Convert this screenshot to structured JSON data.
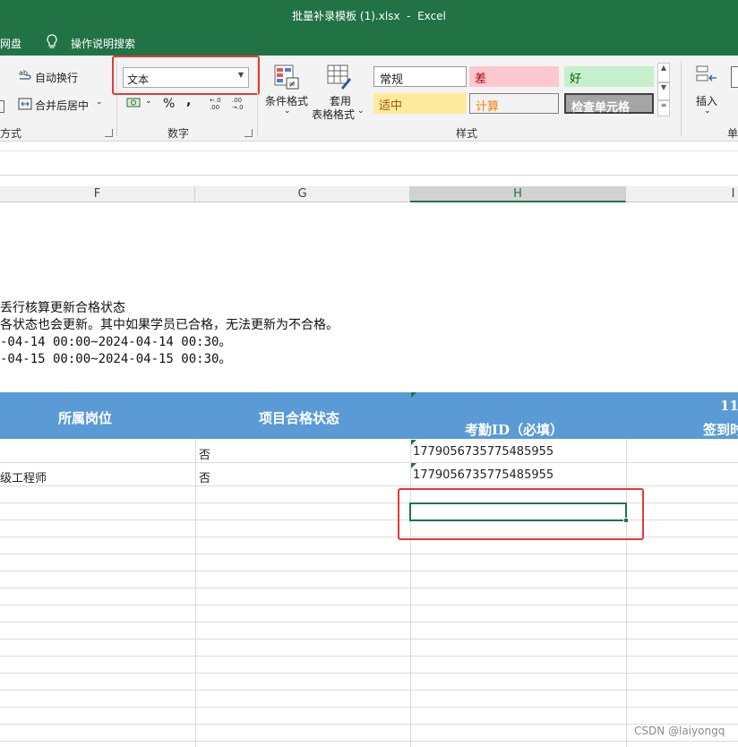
{
  "window": {
    "title": "批量补录模板 (1).xlsx  -  Excel"
  },
  "menu": {
    "item_left": "网盘",
    "tell_me": "操作说明搜索"
  },
  "ribbon": {
    "alignment": {
      "wrap_text": "自动换行",
      "merge_center": "合并后居中",
      "group_label": "方式"
    },
    "number": {
      "format_value": "文本",
      "percent": "%",
      "comma": ",",
      "inc_decimal": "←.0\n.00",
      "dec_decimal": ".00\n→.0",
      "group_label": "数字"
    },
    "styles": {
      "conditional_format": "条件格式",
      "format_as_table_1": "套用",
      "format_as_table_2": "表格格式",
      "cells": [
        {
          "label": "常规",
          "bg": "#ffffff",
          "color": "#222222"
        },
        {
          "label": "差",
          "bg": "#ffc7ce",
          "color": "#9c0006"
        },
        {
          "label": "好",
          "bg": "#c6efce",
          "color": "#006100"
        },
        {
          "label": "适中",
          "bg": "#ffeb9c",
          "color": "#9c5700"
        },
        {
          "label": "计算",
          "bg": "#f2f2f2",
          "color": "#fa7d00"
        },
        {
          "label": "检查单元格",
          "bg": "#a5a5a5",
          "color": "#ffffff"
        }
      ],
      "group_label": "样式"
    },
    "cells_group": {
      "insert": "插入",
      "label_partial": "单"
    }
  },
  "columns": [
    "F",
    "G",
    "H",
    "I"
  ],
  "selected_column": "H",
  "notes": [
    "丢行核算更新合格状态",
    "各状态也会更新。其中如果学员已合格，无法更新为不合格。",
    "-04-14 00:00~2024-04-14 00:30。",
    "-04-15 00:00~2024-04-15 00:30。"
  ],
  "header_row": {
    "position": "所属岗位",
    "qualified_status": "项目合格状态",
    "attendance_id": "考勤ID（必填）",
    "i_top": "11",
    "i_bottom": "签到时"
  },
  "rows": [
    {
      "position": "",
      "status": "否",
      "attendance_id": "1779056735775485955"
    },
    {
      "position": "级工程师",
      "status": "否",
      "attendance_id": "1779056735775485955"
    }
  ],
  "accent": "#217346",
  "header_blue": "#5b9bd5",
  "highlight_red": "#e53935",
  "watermark": "CSDN @laiyongq"
}
